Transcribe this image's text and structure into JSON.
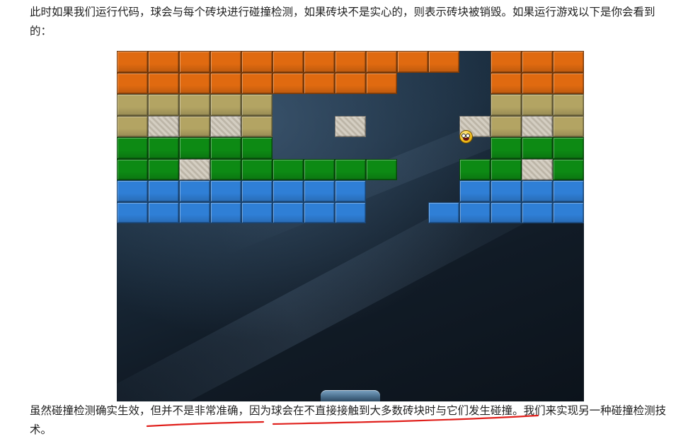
{
  "article": {
    "para_top": "此时如果我们运行代码，球会与每个砖块进行碰撞检测，如果砖块不是实心的，则表示砖块被销毁。如果运行游戏以下是你会看到的：",
    "para_bottom_pre": "虽然碰撞检测确实生效，",
    "para_bottom_u1": "但并不是非常准确",
    "para_bottom_mid": "，",
    "para_bottom_u2": "因为球会在不直接接触到大多数砖块时与它们发生碰撞",
    "para_bottom_post": "。我们来实现另一种碰撞检测技术。"
  },
  "colors": {
    "orange": "#e06a10",
    "olive": "#b3a463",
    "stone": "#c9c2b4",
    "green": "#0d8a14",
    "blue": "#2f7fd6",
    "annotation_red": "#e0201c"
  },
  "game": {
    "cols": 15,
    "rows": [
      "OOOOOOOOOOO.OOOO",
      "OOOOOOOOO...OOO",
      "YYYYY.......YYY",
      "YSYSY..S...SYSY",
      "GGGGG.......GGG",
      "GGSGGGGGG..GGSGG",
      "BBBBBBBB...BBBBB",
      "BBBBBBBB..BBBBB"
    ],
    "ball_icon": "smiley-face-ball-icon",
    "paddle_icon": "paddle-icon"
  }
}
